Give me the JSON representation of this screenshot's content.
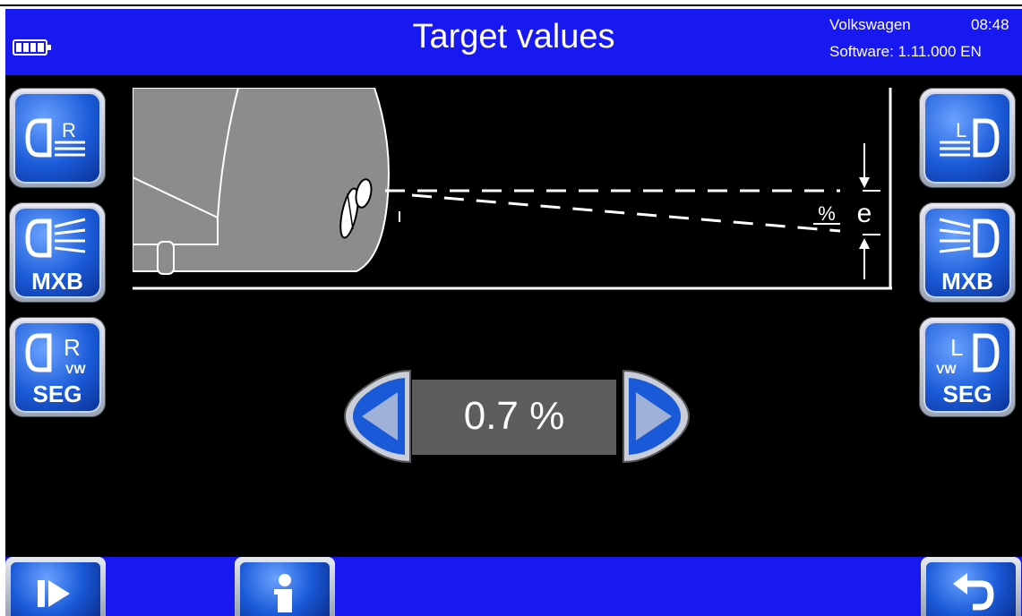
{
  "header": {
    "title": "Target values",
    "brand": "Volkswagen",
    "time": "08:48",
    "software": "Software: 1.11.000 EN",
    "battery_icon": "battery-full-icon"
  },
  "left_buttons": [
    {
      "icon": "right-low-beam-icon",
      "label_letter": "R",
      "sub": ""
    },
    {
      "icon": "right-matrix-beam-icon",
      "label_letter": "",
      "sub": "MXB"
    },
    {
      "icon": "right-vw-segment-icon",
      "label_letter": "R",
      "sub_small": "VW",
      "sub": "SEG"
    }
  ],
  "right_buttons": [
    {
      "icon": "left-low-beam-icon",
      "label_letter": "L",
      "sub": ""
    },
    {
      "icon": "left-matrix-beam-icon",
      "label_letter": "",
      "sub": "MXB"
    },
    {
      "icon": "left-vw-segment-icon",
      "label_letter": "L",
      "sub_small": "VW",
      "sub": "SEG"
    }
  ],
  "diagram": {
    "percent_label": "%",
    "e_label": "e"
  },
  "value": {
    "display": "0.7 %",
    "decrease_icon": "arrow-left-icon",
    "increase_icon": "arrow-right-icon"
  },
  "footer": {
    "next_icon": "skip-forward-icon",
    "info_icon": "info-icon",
    "back_icon": "return-arrow-icon"
  },
  "colors": {
    "header_blue": "#1818f0",
    "button_blue": "#1a5ad8",
    "value_box": "#5d5d5d"
  }
}
